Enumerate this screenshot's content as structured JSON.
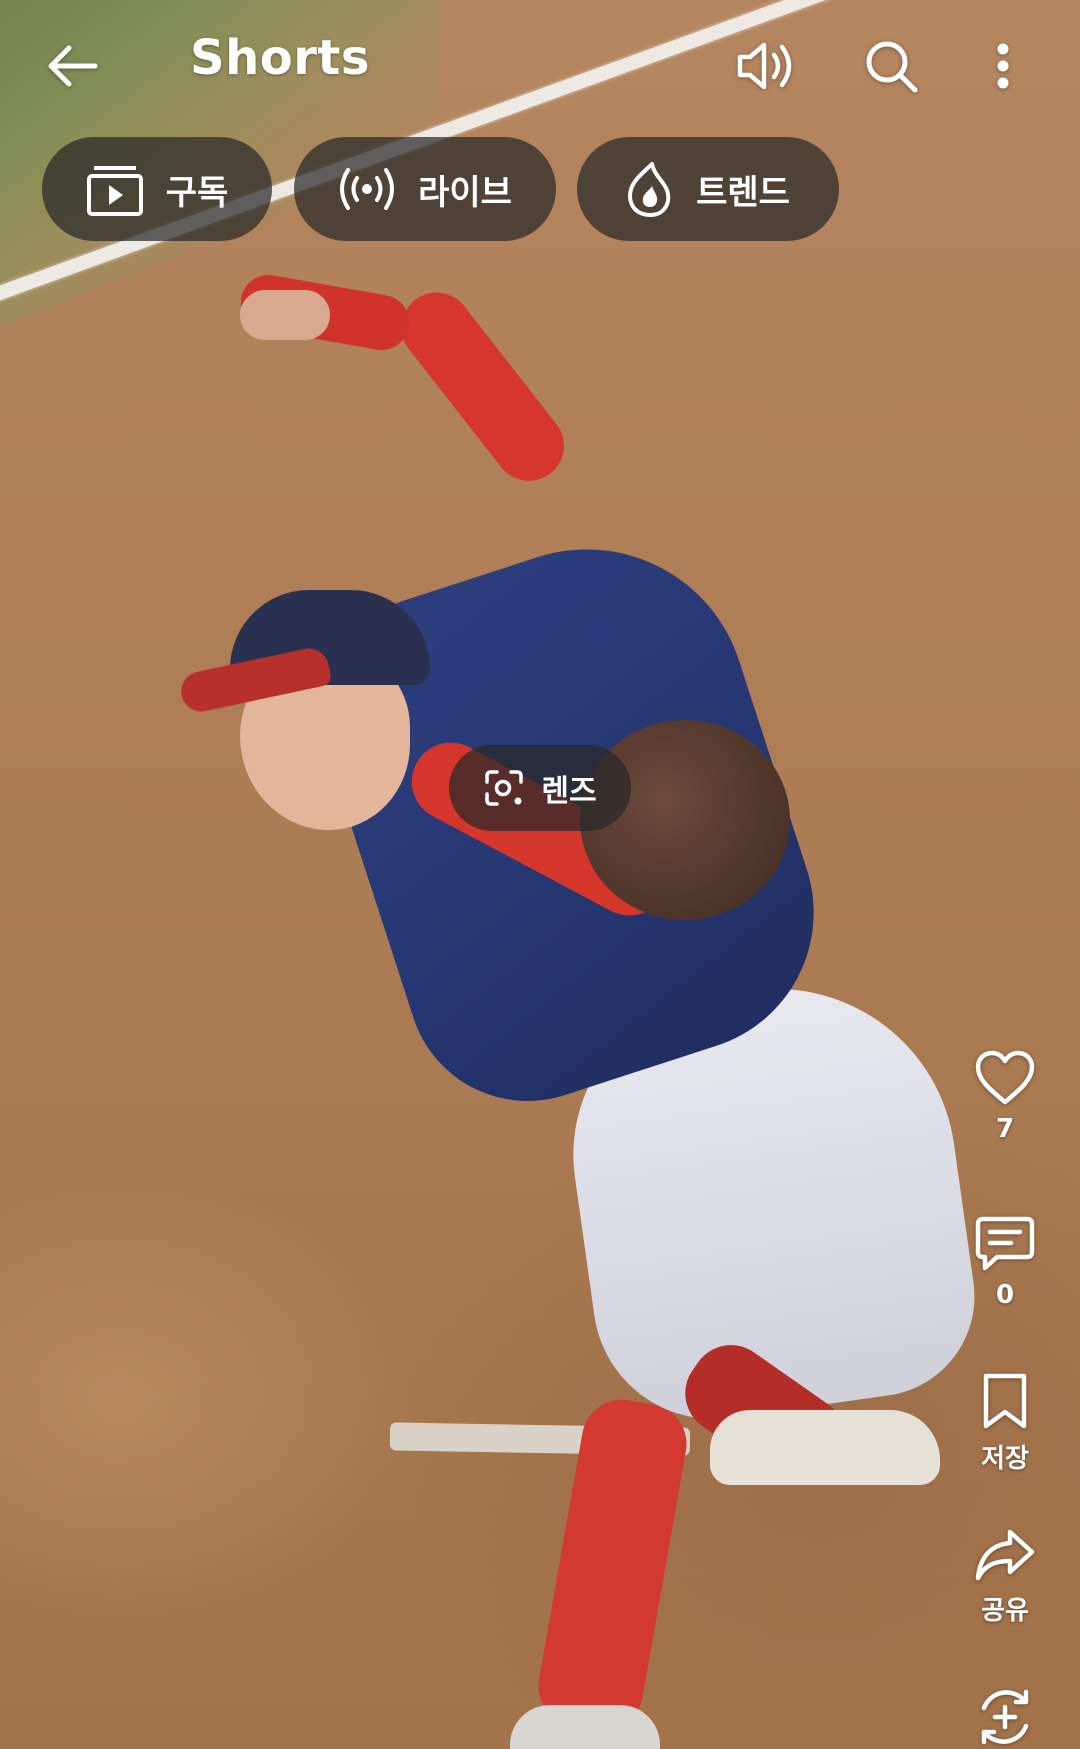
{
  "header": {
    "title": "Shorts",
    "back_icon": "arrow-left-icon",
    "sound_icon": "volume-icon",
    "search_icon": "search-icon",
    "more_icon": "more-vertical-icon"
  },
  "chips": [
    {
      "label": "구독",
      "icon": "subscriptions-icon"
    },
    {
      "label": "라이브",
      "icon": "live-broadcast-icon"
    },
    {
      "label": "트렌드",
      "icon": "trending-flame-icon"
    }
  ],
  "lens": {
    "label": "렌즈",
    "icon": "camera-lens-icon"
  },
  "actions": {
    "like": {
      "count": "7",
      "icon": "heart-icon"
    },
    "comment": {
      "count": "0",
      "icon": "comment-icon"
    },
    "save": {
      "label": "저장",
      "icon": "bookmark-icon"
    },
    "share": {
      "label": "공유",
      "icon": "share-arrow-icon"
    },
    "remix": {
      "icon": "remix-add-icon"
    }
  },
  "colors": {
    "overlay_pill": "#282828",
    "text": "#ffffff"
  }
}
